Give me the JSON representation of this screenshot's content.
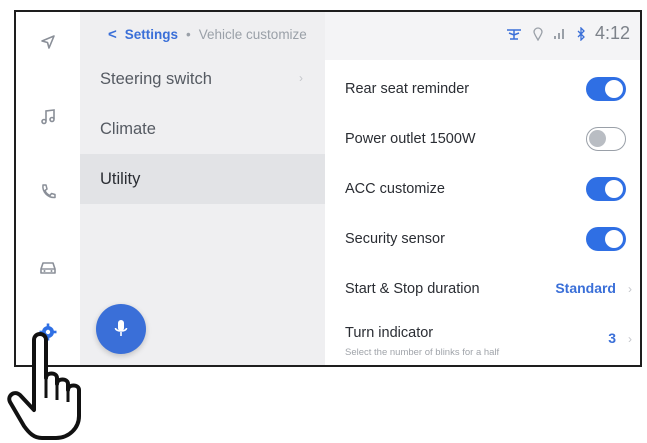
{
  "header": {
    "back_symbol": "<",
    "breadcrumb_root": "Settings",
    "breadcrumb_separator": "•",
    "breadcrumb_current": "Vehicle customize",
    "clock": "4:12"
  },
  "rail": {
    "icons": [
      "navigation-icon",
      "music-icon",
      "phone-icon",
      "car-icon",
      "settings-gear-icon"
    ],
    "active": "settings-gear-icon"
  },
  "menu": {
    "items": [
      {
        "label": "Steering switch",
        "has_chevron": true
      },
      {
        "label": "Climate",
        "has_chevron": false
      },
      {
        "label": "Utility",
        "has_chevron": false,
        "selected": true
      }
    ],
    "chevron": "›"
  },
  "settings": {
    "rows": [
      {
        "label": "Rear seat reminder",
        "control": "toggle",
        "state": "on"
      },
      {
        "label": "Power outlet 1500W",
        "control": "toggle",
        "state": "off"
      },
      {
        "label": "ACC customize",
        "control": "toggle",
        "state": "on"
      },
      {
        "label": "Security sensor",
        "control": "toggle",
        "state": "on"
      },
      {
        "label": "Start & Stop duration",
        "control": "value",
        "value": "Standard"
      },
      {
        "label": "Turn indicator",
        "control": "value",
        "value": "3",
        "sublabel": "Select the number of blinks for a half"
      }
    ],
    "value_chevron": "›"
  },
  "colors": {
    "accent": "#2f6fe4",
    "menu_bg": "#efeff1",
    "selected_bg": "#e2e3e6"
  }
}
